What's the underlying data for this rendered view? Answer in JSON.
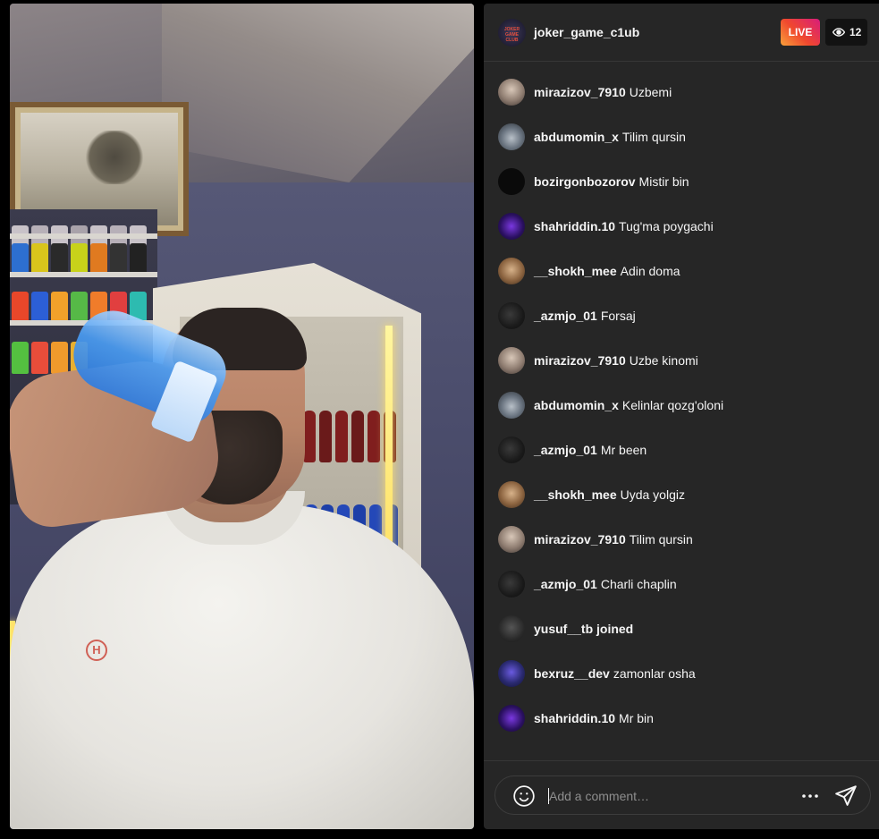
{
  "header": {
    "host_username": "joker_game_c1ub",
    "host_avatar_text": "JOKER GAME CLUB",
    "live_label": "LIVE",
    "viewer_count": "12"
  },
  "comments": [
    {
      "user": "mirazizov_7910",
      "text": "Uzbemi",
      "avatar": "photo-men"
    },
    {
      "user": "abdumomin_x",
      "text": "Tilim qursin",
      "avatar": "car"
    },
    {
      "user": "bozirgonbozorov",
      "text": "Mistir bin",
      "avatar": "black"
    },
    {
      "user": "shahriddin.10",
      "text": "Tug'ma poygachi",
      "avatar": "purple-logo"
    },
    {
      "user": "__shokh_mee",
      "text": "Adin doma",
      "avatar": "portrait"
    },
    {
      "user": "_azmjo_01",
      "text": "Forsaj",
      "avatar": "dark"
    },
    {
      "user": "mirazizov_7910",
      "text": "Uzbe kinomi",
      "avatar": "photo-men"
    },
    {
      "user": "abdumomin_x",
      "text": "Kelinlar qozg'oloni",
      "avatar": "car"
    },
    {
      "user": "_azmjo_01",
      "text": "Mr been",
      "avatar": "dark"
    },
    {
      "user": "__shokh_mee",
      "text": "Uyda yolgiz",
      "avatar": "portrait"
    },
    {
      "user": "mirazizov_7910",
      "text": "Tilim qursin",
      "avatar": "photo-men"
    },
    {
      "user": "_azmjo_01",
      "text": "Charli chaplin",
      "avatar": "dark"
    },
    {
      "user": "yusuf__tb joined",
      "text": "",
      "avatar": "dark-gray"
    },
    {
      "user": "bexruz__dev",
      "text": "zamonlar osha",
      "avatar": "blue-purple"
    },
    {
      "user": "shahriddin.10",
      "text": "Mr bin",
      "avatar": "purple-logo"
    }
  ],
  "composer": {
    "placeholder": "Add a comment…"
  },
  "icons": {
    "viewer": "eye-icon",
    "emoji": "smiley-icon",
    "more": "more-options-icon",
    "send": "send-icon"
  },
  "colors": {
    "panel_bg": "#262626",
    "live_gradient": [
      "#f9a13a",
      "#f0482e",
      "#d81c7b"
    ]
  }
}
